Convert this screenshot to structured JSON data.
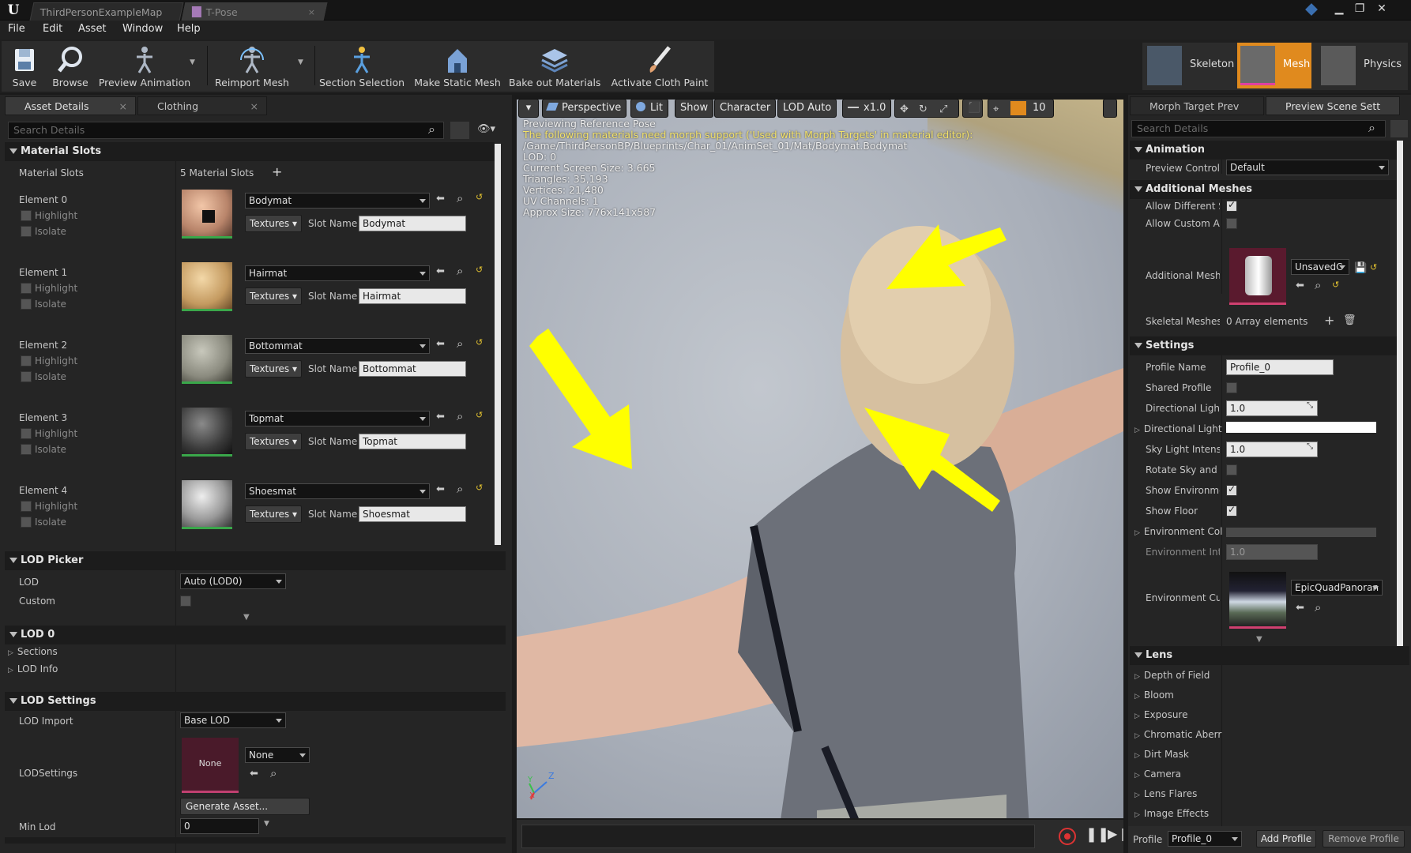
{
  "titlebar": {
    "tabs": [
      "ThirdPersonExampleMap",
      "T-Pose"
    ],
    "close_glyph": "×"
  },
  "menu": [
    "File",
    "Edit",
    "Asset",
    "Window",
    "Help"
  ],
  "toolbar": {
    "buttons": [
      "Save",
      "Browse",
      "Preview Animation",
      "Reimport Mesh",
      "Section Selection",
      "Make Static Mesh",
      "Bake out Materials",
      "Activate Cloth Paint"
    ]
  },
  "modes": [
    "Skeleton",
    "Mesh",
    "Physics"
  ],
  "left_panel": {
    "tabs": [
      "Asset Details",
      "Clothing"
    ],
    "search_placeholder": "Search Details",
    "material_slots": {
      "header": "Material Slots",
      "label": "Material Slots",
      "count": "5 Material Slots",
      "highlight": "Highlight",
      "isolate": "Isolate",
      "textures": "Textures",
      "slot_name_label": "Slot Name",
      "elements": [
        {
          "label": "Element 0",
          "material": "Bodymat",
          "slot": "Bodymat"
        },
        {
          "label": "Element 1",
          "material": "Hairmat",
          "slot": "Hairmat"
        },
        {
          "label": "Element 2",
          "material": "Bottommat",
          "slot": "Bottommat"
        },
        {
          "label": "Element 3",
          "material": "Topmat",
          "slot": "Topmat"
        },
        {
          "label": "Element 4",
          "material": "Shoesmat",
          "slot": "Shoesmat"
        }
      ]
    },
    "lod_picker": {
      "header": "LOD Picker",
      "lod_label": "LOD",
      "lod_value": "Auto (LOD0)",
      "custom_label": "Custom"
    },
    "lod0": {
      "header": "LOD 0",
      "sections": "Sections",
      "lod_info": "LOD Info"
    },
    "lod_settings": {
      "header": "LOD Settings",
      "import_label": "LOD Import",
      "import_value": "Base LOD",
      "settings_label": "LODSettings",
      "none_thumb": "None",
      "none_combo": "None",
      "generate": "Generate Asset...",
      "min_lod_label": "Min Lod",
      "min_lod_value": "0"
    }
  },
  "viewport": {
    "buttons": {
      "perspective": "Perspective",
      "lit": "Lit",
      "show": "Show",
      "character": "Character",
      "lod": "LOD Auto",
      "speed": "x1.0",
      "grid": "10"
    },
    "overlay": {
      "line1": "Previewing Reference Pose",
      "warning": "The following materials need morph support ('Used with Morph Targets' in material editor):",
      "path": "/Game/ThirdPersonBP/Blueprints/Char_01/AnimSet_01/Mat/Bodymat.Bodymat",
      "lod": "LOD: 0",
      "screen_size": "Current Screen Size: 3.665",
      "triangles": "Triangles: 35,193",
      "vertices": "Vertices: 21,480",
      "uv": "UV Channels: 1",
      "approx": "Approx Size: 776x141x587"
    },
    "axis": {
      "z": "Z",
      "y": "Y",
      "x": "X"
    }
  },
  "right_panel": {
    "tabs": [
      "Morph Target Prev",
      "Preview Scene Sett"
    ],
    "search_placeholder": "Search Details",
    "animation": {
      "header": "Animation",
      "controller_label": "Preview Controlle",
      "controller_value": "Default"
    },
    "additional_meshes": {
      "header": "Additional Meshes",
      "allow_diff": "Allow Different Sl",
      "allow_custom": "Allow Custom An",
      "meshes_label": "Additional Meshe",
      "asset_combo": "UnsavedC",
      "skeletal_label": "Skeletal Meshes",
      "skeletal_value": "0 Array elements"
    },
    "settings": {
      "header": "Settings",
      "profile_name_label": "Profile Name",
      "profile_name_value": "Profile_0",
      "shared_profile": "Shared Profile",
      "dir_light_intensity_label": "Directional Light I",
      "dir_light_intensity_value": "1.0",
      "dir_light_label": "Directional Light",
      "sky_light_label": "Sky Light Intensit",
      "sky_light_value": "1.0",
      "rotate_sky": "Rotate Sky and D",
      "show_env": "Show Environmer",
      "show_floor": "Show Floor",
      "env_color": "Environment Colo",
      "env_intensity_label": "Environment Inter",
      "env_intensity_value": "1.0",
      "env_cube_label": "Environment Cub",
      "env_cube_value": "EpicQuadPanoran"
    },
    "lens": {
      "header": "Lens",
      "items": [
        "Depth of Field",
        "Bloom",
        "Exposure",
        "Chromatic Aberr",
        "Dirt Mask",
        "Camera",
        "Lens Flares",
        "Image Effects"
      ]
    },
    "footer": {
      "profile_label": "Profile",
      "profile_value": "Profile_0",
      "add": "Add Profile",
      "remove": "Remove Profile"
    }
  },
  "colors": {
    "accent_orange": "#e08a1e",
    "warning_yellow": "#f3e26a",
    "arrow_yellow": "#ffff00",
    "thumb_green": "#3aa74a",
    "record_red": "#d33"
  }
}
